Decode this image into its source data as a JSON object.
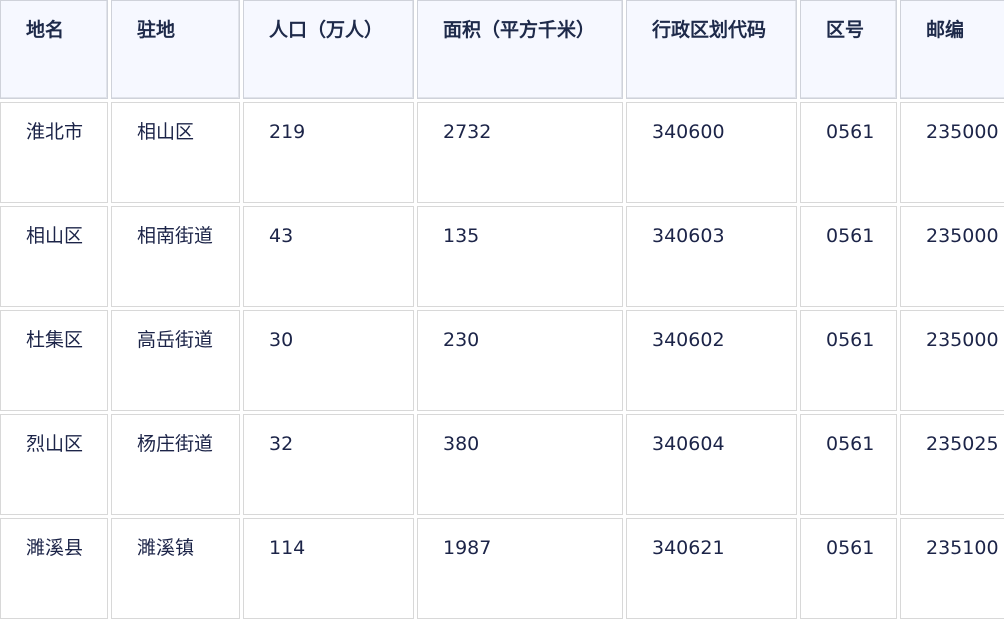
{
  "table": {
    "headers": [
      "地名",
      "驻地",
      "人口（万人）",
      "面积（平方千米）",
      "行政区划代码",
      "区号",
      "邮编"
    ],
    "rows": [
      [
        "淮北市",
        "相山区",
        "219",
        "2732",
        "340600",
        "0561",
        "235000"
      ],
      [
        "相山区",
        "相南街道",
        "43",
        "135",
        "340603",
        "0561",
        "235000"
      ],
      [
        "杜集区",
        "高岳街道",
        "30",
        "230",
        "340602",
        "0561",
        "235000"
      ],
      [
        "烈山区",
        "杨庄街道",
        "32",
        "380",
        "340604",
        "0561",
        "235025"
      ],
      [
        "濉溪县",
        "濉溪镇",
        "114",
        "1987",
        "340621",
        "0561",
        "235100"
      ]
    ]
  }
}
